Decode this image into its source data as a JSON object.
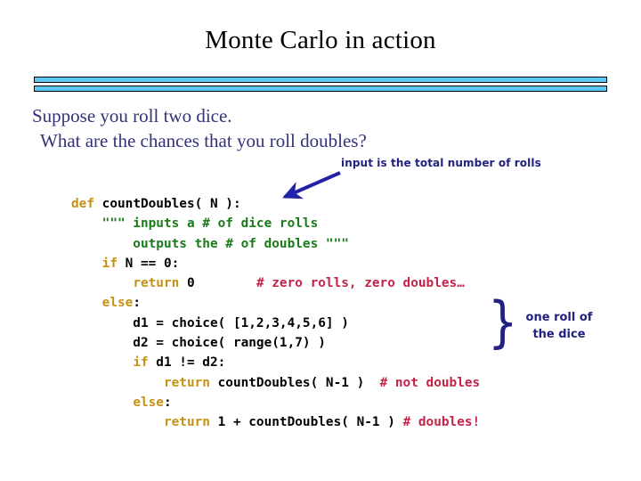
{
  "slide": {
    "title": "Monte Carlo in action",
    "divider_color": "#5CC9F5",
    "prose": {
      "line1": "Suppose you roll two dice.",
      "line2": "What are the chances that you roll doubles?",
      "color": "#32327A"
    },
    "annotations": {
      "input_note": "input is the total number of rolls",
      "brace_glyph": "}",
      "roll_note_line1": "one roll of",
      "roll_note_line2": "the dice",
      "color": "#222080",
      "arrow_color": "#2222A8"
    },
    "code": {
      "keyword_color": "#C69214",
      "string_color": "#197B19",
      "comment_color": "#C42448",
      "lines": [
        {
          "indent": 0,
          "tokens": [
            {
              "t": "def",
              "c": "kw"
            },
            {
              "t": " countDoubles( N ):",
              "c": "id"
            }
          ]
        },
        {
          "indent": 0,
          "tokens": [
            {
              "t": "    \"\"\" inputs a # of dice rolls",
              "c": "str"
            }
          ]
        },
        {
          "indent": 0,
          "tokens": [
            {
              "t": "        outputs the # of doubles \"\"\"",
              "c": "str"
            }
          ]
        },
        {
          "indent": 0,
          "tokens": [
            {
              "t": "    ",
              "c": "id"
            },
            {
              "t": "if",
              "c": "kw"
            },
            {
              "t": " N == 0:",
              "c": "id"
            }
          ]
        },
        {
          "indent": 0,
          "tokens": [
            {
              "t": "        ",
              "c": "id"
            },
            {
              "t": "return",
              "c": "kw"
            },
            {
              "t": " 0        ",
              "c": "id"
            },
            {
              "t": "# zero rolls, zero doubles…",
              "c": "com"
            }
          ]
        },
        {
          "indent": 0,
          "tokens": [
            {
              "t": "    ",
              "c": "id"
            },
            {
              "t": "else",
              "c": "kw"
            },
            {
              "t": ":",
              "c": "id"
            }
          ]
        },
        {
          "indent": 0,
          "tokens": [
            {
              "t": "        d1 = choice( [1,2,3,4,5,6] )",
              "c": "id"
            }
          ]
        },
        {
          "indent": 0,
          "tokens": [
            {
              "t": "        d2 = choice( range(1,7) )",
              "c": "id"
            }
          ]
        },
        {
          "indent": 0,
          "tokens": [
            {
              "t": "        ",
              "c": "id"
            },
            {
              "t": "if",
              "c": "kw"
            },
            {
              "t": " d1 != d2:",
              "c": "id"
            }
          ]
        },
        {
          "indent": 0,
          "tokens": [
            {
              "t": "            ",
              "c": "id"
            },
            {
              "t": "return",
              "c": "kw"
            },
            {
              "t": " countDoubles( N-1 )  ",
              "c": "id"
            },
            {
              "t": "# not doubles",
              "c": "com"
            }
          ]
        },
        {
          "indent": 0,
          "tokens": [
            {
              "t": "        ",
              "c": "id"
            },
            {
              "t": "else",
              "c": "kw"
            },
            {
              "t": ":",
              "c": "id"
            }
          ]
        },
        {
          "indent": 0,
          "tokens": [
            {
              "t": "            ",
              "c": "id"
            },
            {
              "t": "return",
              "c": "kw"
            },
            {
              "t": " 1 + countDoubles( N-1 ) ",
              "c": "id"
            },
            {
              "t": "# doubles!",
              "c": "com"
            }
          ]
        }
      ]
    }
  }
}
